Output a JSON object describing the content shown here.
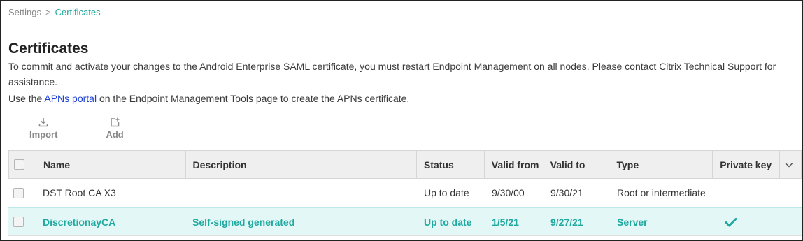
{
  "breadcrumb": {
    "root": "Settings",
    "separator": ">",
    "current": "Certificates"
  },
  "page": {
    "title": "Certificates",
    "description1": "To commit and activate your changes to the Android Enterprise SAML certificate, you must restart Endpoint Management on all nodes. Please contact Citrix Technical Support for assistance.",
    "description2_before": "Use the ",
    "description2_link": "APNs portal",
    "description2_after": " on the Endpoint Management Tools page to create the APNs certificate."
  },
  "toolbar": {
    "import_label": "Import",
    "add_label": "Add"
  },
  "table": {
    "columns": [
      "Name",
      "Description",
      "Status",
      "Valid from",
      "Valid to",
      "Type",
      "Private key"
    ],
    "rows": [
      {
        "name": "DST Root CA X3",
        "description": "",
        "status": "Up to date",
        "valid_from": "9/30/00",
        "valid_to": "9/30/21",
        "type": "Root or intermediate",
        "private_key": false,
        "selected": false
      },
      {
        "name": "DiscretionayCA",
        "description": "Self-signed generated",
        "status": "Up to date",
        "valid_from": "1/5/21",
        "valid_to": "9/27/21",
        "type": "Server",
        "private_key": true,
        "selected": true
      }
    ]
  },
  "colors": {
    "accent": "#1fa9a0",
    "link": "#1a3fd6",
    "selected_row_bg": "#e3f7f6",
    "header_bg": "#efefef"
  },
  "icons": {
    "import": "import-icon",
    "add": "add-icon",
    "column_menu": "chevron-down-icon",
    "private_key": "checkmark-icon"
  }
}
